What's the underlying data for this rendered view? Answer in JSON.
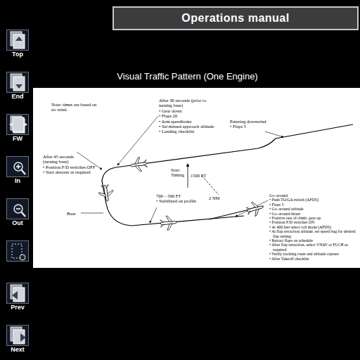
{
  "header": {
    "title": "Operations manual"
  },
  "toolbar": [
    {
      "label": "Top"
    },
    {
      "label": "End"
    },
    {
      "label": "FW"
    },
    {
      "label": "In"
    },
    {
      "label": "Out"
    },
    {},
    {
      "label": "Prev"
    },
    {
      "label": "Next"
    }
  ],
  "diagram": {
    "title": "Visual Traffic Pattern (One Engine)",
    "note": {
      "heading": [
        "Note: times are based on",
        "no wind."
      ],
      "items": []
    },
    "after_30_seconds": {
      "heading": [
        "After 30 seconds (prior to",
        "turning base)"
      ],
      "items": [
        "• Gear down",
        "• Flaps 20",
        "• Arm speedbrake",
        "• Set missed approach altitude",
        "• Landing checklist"
      ]
    },
    "entering_downwind": {
      "heading": [
        "Entering downwind"
      ],
      "items": [
        "• Flaps 5"
      ]
    },
    "after_45_seconds": {
      "heading": [
        "After 45 seconds",
        "(turning base)"
      ],
      "items": [
        "• Position F/D switches OFF",
        "• Start descent as required"
      ]
    },
    "start_timing": {
      "heading": [
        "Start",
        "Timing"
      ],
      "items": []
    },
    "altitude": "1500 FT",
    "distance": "2 NM",
    "final": {
      "heading": [
        "700 – 500 FT"
      ],
      "items": [
        "• Stabilized on profile"
      ]
    },
    "base": "Base",
    "go_around": {
      "heading": [
        "Go–around"
      ],
      "items": [
        "• Push TO/GA switch (AFDS)",
        "• Flaps 5",
        "• Go–around attitude",
        "• Go–around thrust",
        "• Positive rate of climb, gear up",
        "• Position F/D switches ON",
        "• At 400 feet select roll mode (AFDS)",
        "• At flap retraction altitude, set speed bug for desired flap setting",
        "• Retract flaps on schedule",
        "• After flap retraction, select VNAV or FLCH as required",
        "• Verify tracking route and altitude capture",
        "• After Takeoff checklist"
      ]
    }
  }
}
